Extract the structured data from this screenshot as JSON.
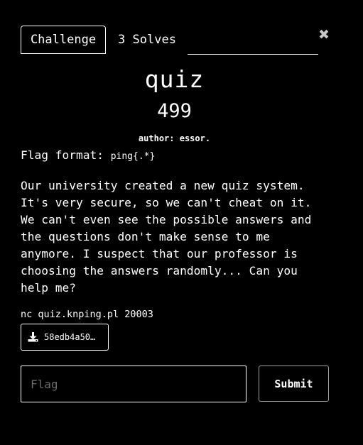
{
  "tabs": {
    "challenge_label": "Challenge",
    "solves_label": "3 Solves"
  },
  "close_icon": "✖",
  "challenge": {
    "name": "quiz",
    "points": "499",
    "author": "author: essor.",
    "flag_format_prefix": "Flag format: ",
    "flag_format_code": "ping{.*}",
    "description_lines": [
      "Our university created a new quiz system.",
      "It's very secure, so we can't cheat on it.",
      "We can't even see the possible answers and",
      "the questions don't make sense to me",
      "anymore. I suspect that our professor is",
      "choosing the answers randomly... Can you",
      "help me?"
    ],
    "connection": "nc quiz.knping.pl 20003",
    "file_label": "58edb4a50…",
    "file_icon": "download-icon"
  },
  "form": {
    "flag_placeholder": "Flag",
    "flag_value": "",
    "submit_label": "Submit"
  },
  "colors": {
    "background": "#000000",
    "text": "#ffffff",
    "placeholder": "#6b6b6b",
    "close": "#c9c9c9"
  }
}
